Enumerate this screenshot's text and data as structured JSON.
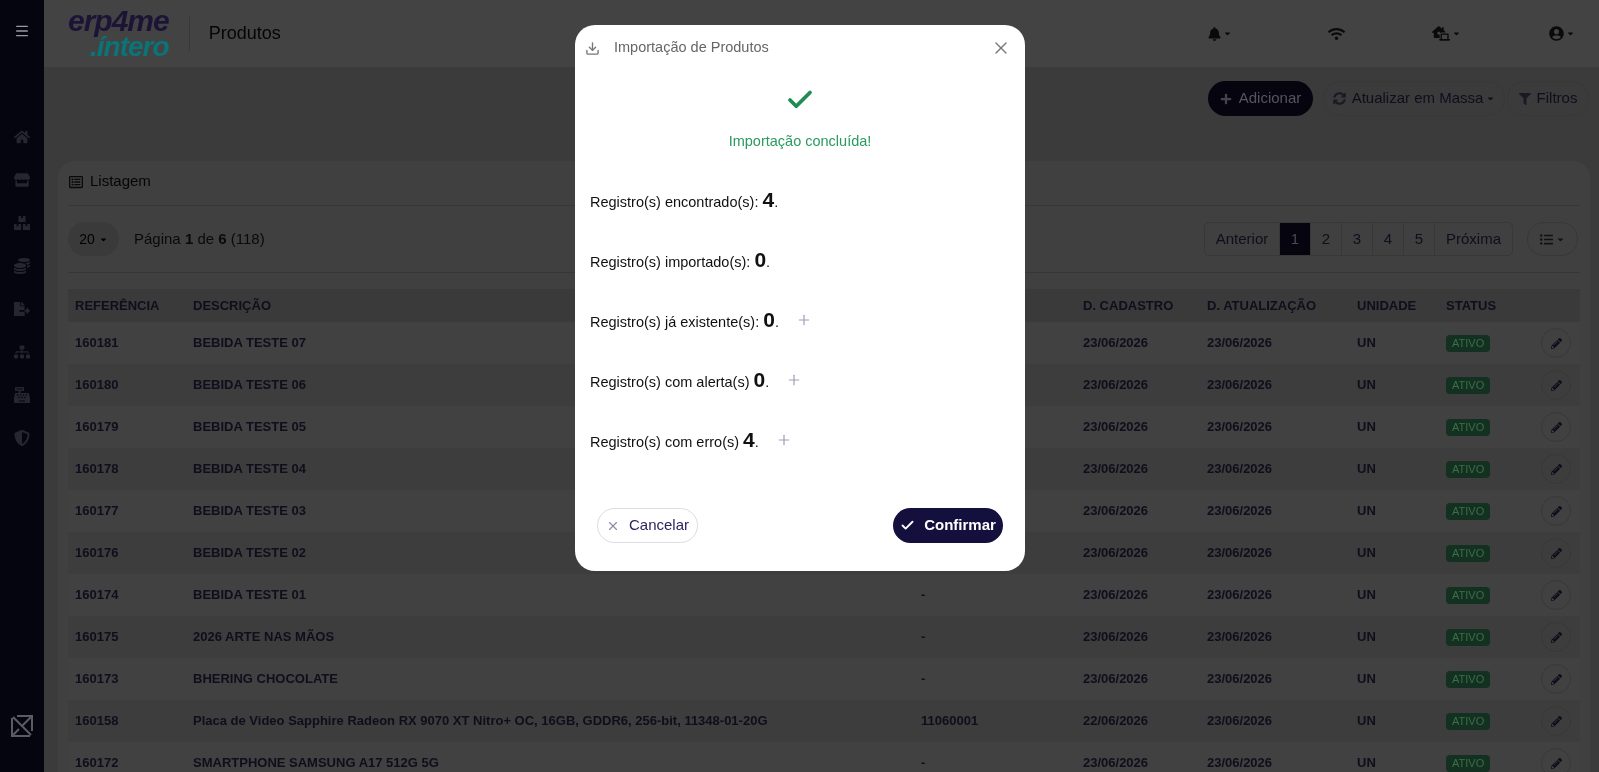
{
  "header": {
    "logo": {
      "line_1": "erp4me",
      "line_2": ".íntero"
    },
    "title": "Produtos"
  },
  "toolbar": {
    "buttons": [
      {
        "kind": "primary",
        "label": "Adicionar"
      },
      {
        "kind": "dropdown",
        "label": "Atualizar em Massa"
      },
      {
        "kind": "filter",
        "label": "Filtros"
      }
    ]
  },
  "listing": {
    "title": "Listagem",
    "page_size": "20",
    "page_info": "Página **1** de **6** (118)",
    "pagination": {
      "previous": "Anterior",
      "pages": [
        {
          "label": "1",
          "selected": true
        },
        {
          "label": "2",
          "selected": false
        },
        {
          "label": "3",
          "selected": false
        },
        {
          "label": "4",
          "selected": false
        },
        {
          "label": "5",
          "selected": false
        }
      ],
      "next": "Próxima"
    }
  },
  "table": {
    "columns": [
      "REFERÊNCIA",
      "DESCRIÇÃO",
      "D. CADASTRO",
      "D. ATUALIZAÇÃO",
      "UNIDADE",
      "STATUS"
    ],
    "rows": [
      {
        "reference": "160181",
        "description": "BEBIDA TESTE 07",
        "created": "23/06/2026",
        "updated": "23/06/2026",
        "unit": "UN",
        "status": "ATIVO"
      },
      {
        "reference": "160180",
        "description": "BEBIDA TESTE 06",
        "created": "23/06/2026",
        "updated": "23/06/2026",
        "unit": "UN",
        "status": "ATIVO"
      },
      {
        "reference": "160179",
        "description": "BEBIDA TESTE 05",
        "created": "23/06/2026",
        "updated": "23/06/2026",
        "unit": "UN",
        "status": "ATIVO"
      },
      {
        "reference": "160178",
        "description": "BEBIDA TESTE 04",
        "created": "23/06/2026",
        "updated": "23/06/2026",
        "unit": "UN",
        "status": "ATIVO"
      },
      {
        "reference": "160177",
        "description": "BEBIDA TESTE 03",
        "created": "23/06/2026",
        "updated": "23/06/2026",
        "unit": "UN",
        "status": "ATIVO"
      },
      {
        "reference": "160176",
        "description": "BEBIDA TESTE 02",
        "created": "23/06/2026",
        "updated": "23/06/2026",
        "unit": "UN",
        "status": "ATIVO"
      },
      {
        "reference": "160174",
        "description": "BEBIDA TESTE 01",
        "column_3": "-",
        "created": "23/06/2026",
        "updated": "23/06/2026",
        "unit": "UN",
        "status": "ATIVO"
      },
      {
        "reference": "160175",
        "description": "2026 ARTE NAS MÃOS",
        "column_3": "-",
        "created": "23/06/2026",
        "updated": "23/06/2026",
        "unit": "UN",
        "status": "ATIVO"
      },
      {
        "reference": "160173",
        "description": "BHERING CHOCOLATE",
        "column_3": "-",
        "created": "23/06/2026",
        "updated": "23/06/2026",
        "unit": "UN",
        "status": "ATIVO"
      },
      {
        "reference": "160158",
        "description": "Placa de Video Sapphire Radeon RX 9070 XT Nitro+ OC, 16GB, GDDR6, 256-bit, 11348-01-20G",
        "column_3": "11060001",
        "created": "22/06/2026",
        "updated": "23/06/2026",
        "unit": "UN",
        "status": "ATIVO"
      },
      {
        "reference": "160172",
        "description": "SMARTPHONE SAMSUNG A17 512G 5G",
        "column_3": "-",
        "created": "23/06/2026",
        "updated": "23/06/2026",
        "unit": "UN",
        "status": "ATIVO"
      }
    ]
  },
  "modal": {
    "title": "Importação de Produtos",
    "status": "Importação concluída!",
    "lines": [
      {
        "text": "Registro(s) encontrado(s): **4**.",
        "expandable": false
      },
      {
        "text": "Registro(s) importado(s): **0**.",
        "expandable": false
      },
      {
        "text": "Registro(s) já existente(s): **0**.",
        "expandable": true
      },
      {
        "text": "Registro(s) com alerta(s) **0**.",
        "expandable": true
      },
      {
        "text": "Registro(s) com erro(s) **4**.",
        "expandable": true
      }
    ],
    "buttons": {
      "cancel": "Cancelar",
      "confirm": "Confirmar"
    }
  }
}
